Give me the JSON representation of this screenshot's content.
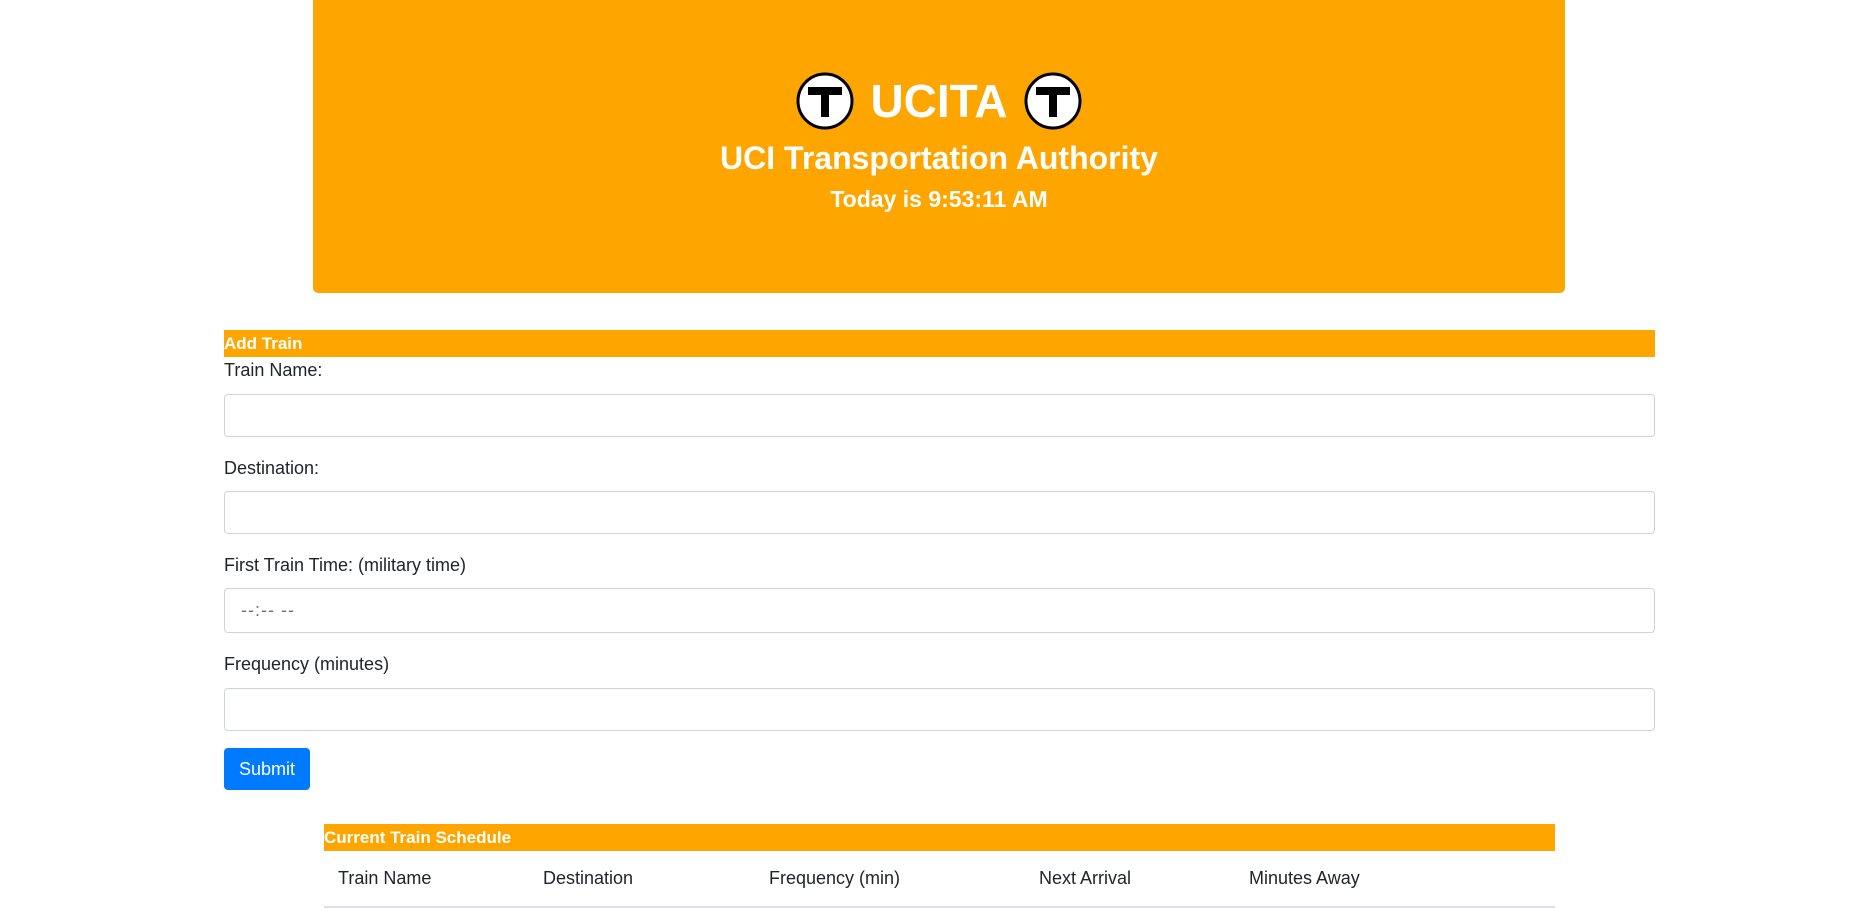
{
  "header": {
    "brand_title": "UCITA",
    "subtitle": "UCI Transportation Authority",
    "clock_text": "Today is 9:53:11 AM",
    "logo_icon": "t-logo-icon",
    "logo_letter": "T",
    "accent_color": "#ffa500"
  },
  "add_train": {
    "section_title": "Add Train",
    "train_name_label": "Train Name:",
    "train_name_value": "",
    "destination_label": "Destination:",
    "destination_value": "",
    "first_train_label": "First Train Time: (military time)",
    "first_train_placeholder": "--:-- --",
    "frequency_label": "Frequency (minutes)",
    "frequency_value": "",
    "submit_label": "Submit",
    "submit_color": "#007bff"
  },
  "schedule": {
    "section_title": "Current Train Schedule",
    "columns": [
      "Train Name",
      "Destination",
      "Frequency (min)",
      "Next Arrival",
      "Minutes Away"
    ],
    "rows": []
  }
}
